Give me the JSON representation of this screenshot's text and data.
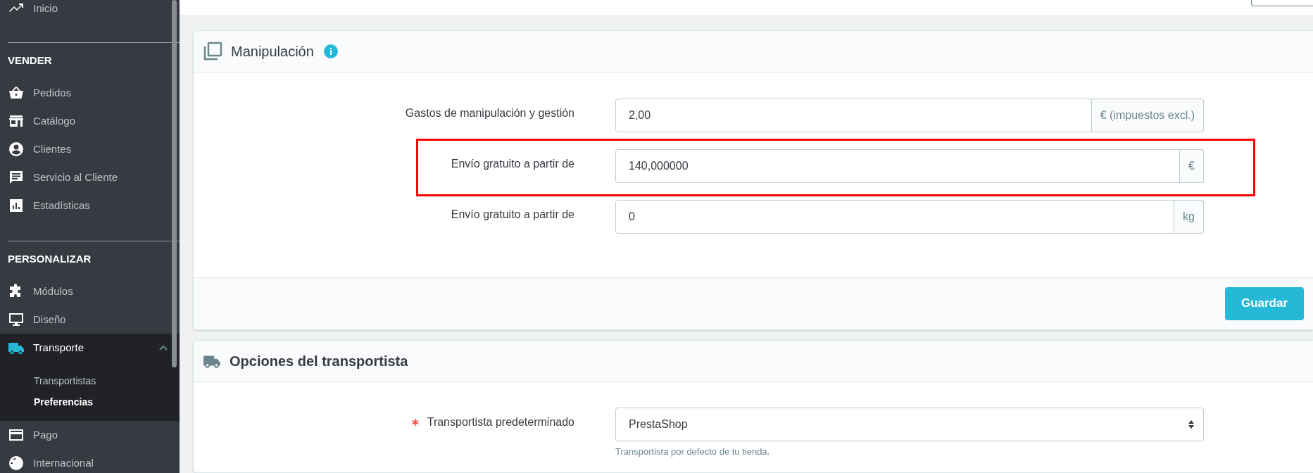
{
  "sidebar": {
    "sections": [
      {
        "items": [
          {
            "label": "Inicio",
            "selected": false
          }
        ]
      },
      {
        "title": "VENDER",
        "items": [
          {
            "label": "Pedidos",
            "selected": false
          },
          {
            "label": "Catálogo",
            "selected": false
          },
          {
            "label": "Clientes",
            "selected": false
          },
          {
            "label": "Servicio al Cliente",
            "selected": false
          },
          {
            "label": "Estadísticas",
            "selected": false
          }
        ]
      },
      {
        "title": "PERSONALIZAR",
        "items": [
          {
            "label": "Módulos",
            "selected": false
          },
          {
            "label": "Diseño",
            "selected": false
          },
          {
            "label": "Transporte",
            "selected": true,
            "expanded": true,
            "children": [
              {
                "label": "Transportistas",
                "selected": false
              },
              {
                "label": "Preferencias",
                "selected": true
              }
            ]
          },
          {
            "label": "Pago",
            "selected": false
          },
          {
            "label": "Internacional",
            "selected": false
          }
        ]
      }
    ]
  },
  "panels": [
    {
      "title": "Manipulación",
      "info": true,
      "fields": [
        {
          "kind": "input",
          "label": "Gastos de manipulación y gestión",
          "value": "2,00",
          "addon": "€ (impuestos excl.)",
          "highlighted": false
        },
        {
          "kind": "input",
          "label": "Envío gratuito a partir de",
          "value": "140,000000",
          "addon": "€",
          "highlighted": true
        },
        {
          "kind": "input",
          "label": "Envío gratuito a partir de",
          "value": "0",
          "addon": "kg",
          "highlighted": false
        }
      ],
      "button": "Guardar"
    },
    {
      "title": "Opciones del transportista",
      "fields": [
        {
          "kind": "select",
          "label": "Transportista predeterminado",
          "required": true,
          "value": "PrestaShop",
          "help": "Transportista por defecto de tu tienda.",
          "highlighted": false
        }
      ]
    }
  ]
}
